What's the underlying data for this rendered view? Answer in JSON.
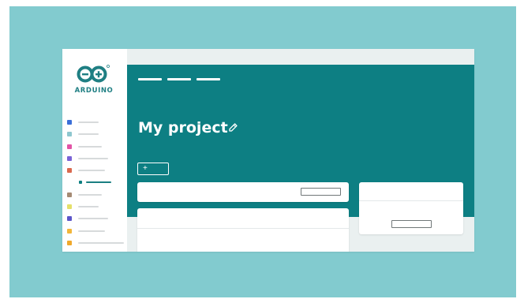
{
  "app": {
    "brand": "ARDUINO"
  },
  "colors": {
    "background": "#82cbcf",
    "header": "#0d7f83",
    "accent": "#1f7f83"
  },
  "sidebar": {
    "items": [
      {
        "icon_color": "#3b6fd8",
        "label": "",
        "type": "item"
      },
      {
        "icon_color": "#8ec7cf",
        "label": "",
        "type": "item"
      },
      {
        "icon_color": "#e254a6",
        "label": "",
        "type": "item"
      },
      {
        "icon_color": "#7a63d6",
        "label": "",
        "type": "item"
      },
      {
        "icon_color": "#d9694e",
        "label": "",
        "type": "item"
      },
      {
        "icon_color": "#0b7e80",
        "label": "",
        "type": "sub-item-selected"
      },
      {
        "icon_color": "#a58b74",
        "label": "",
        "type": "item"
      },
      {
        "icon_color": "#e5e06a",
        "label": "",
        "type": "item"
      },
      {
        "icon_color": "#5b55c9",
        "label": "",
        "type": "item"
      },
      {
        "icon_color": "#f2b63a",
        "label": "",
        "type": "item"
      },
      {
        "icon_color": "#f0a92c",
        "label": "",
        "type": "item"
      }
    ]
  },
  "header": {
    "title": "My project",
    "edit_icon": "edit-icon",
    "add_button_label": "+"
  },
  "icons": {
    "logo": "arduino-logo-icon",
    "edit": "edit-icon"
  }
}
